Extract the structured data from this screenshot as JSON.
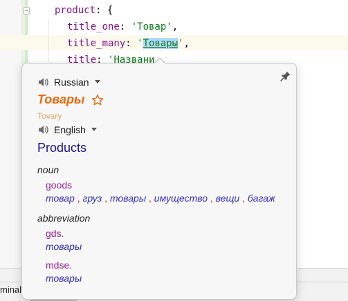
{
  "editor": {
    "line1": {
      "key": "product",
      "punc": ": {"
    },
    "line2": {
      "key": "title_one",
      "punc": ": ",
      "str": "'Товар'",
      "tail": ","
    },
    "line3": {
      "key": "title_many",
      "punc": ": ",
      "q1": "'",
      "hl": "Товары",
      "q2": "'",
      "tail": ","
    },
    "line4": {
      "key": "title",
      "punc": ": ",
      "str": "'Названи"
    }
  },
  "bottom": {
    "terminal_tab": "minal"
  },
  "popup": {
    "source_lang": "Russian",
    "source_word": "Товары",
    "transliteration": "Tovary",
    "target_lang": "English",
    "target_word": "Products",
    "entries": [
      {
        "pos": "noun",
        "terms": [
          {
            "term": "goods",
            "synonyms": [
              "товар",
              "груз",
              "товары",
              "имущество",
              "вещи",
              "багаж"
            ]
          }
        ]
      },
      {
        "pos": "abbreviation",
        "terms": [
          {
            "term": "gds.",
            "synonyms": [
              "товары"
            ]
          },
          {
            "term": "mdse.",
            "synonyms": [
              "товары"
            ]
          }
        ]
      }
    ]
  },
  "colors": {
    "source_word": "#ea6a12",
    "target_word": "#141496",
    "term": "#a0209a",
    "synonym": "#2f2fc6",
    "separator": "#e0281f"
  },
  "icons": [
    "speaker-icon",
    "chevron-down-icon",
    "star-icon",
    "pin-icon"
  ]
}
